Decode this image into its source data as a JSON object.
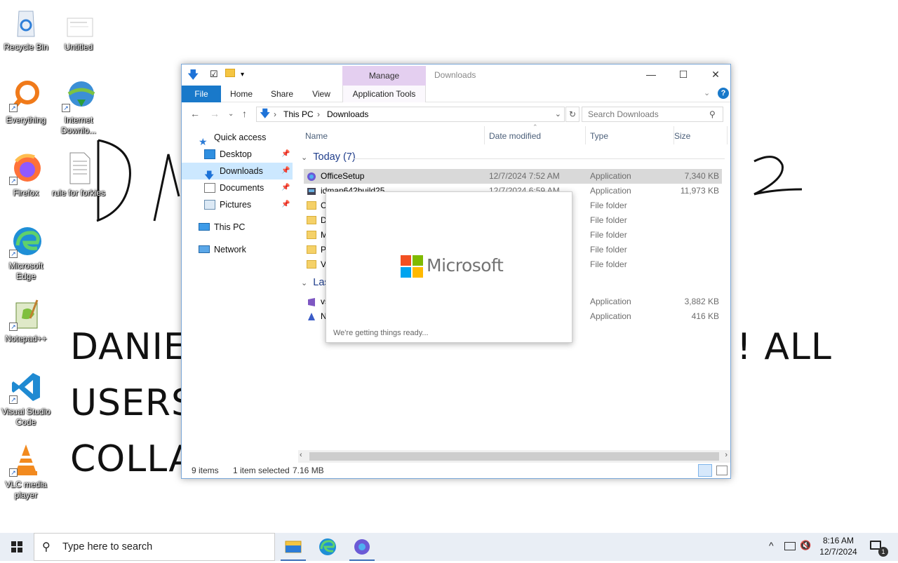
{
  "desktop": {
    "background_text": {
      "line1_left": "DANIE",
      "line1_right": "! ALL",
      "line2": "USERS",
      "line3": "COLLA",
      "scrawl_left": "DA",
      "scrawl_right": "2"
    },
    "icons": [
      {
        "label": "Recycle Bin",
        "icon": "recycle-bin-icon"
      },
      {
        "label": "Untitled",
        "icon": "document-icon"
      },
      {
        "label": "Everything",
        "icon": "everything-search-icon"
      },
      {
        "label": "Internet Downlo...",
        "icon": "internet-download-manager-icon"
      },
      {
        "label": "Firefox",
        "icon": "firefox-icon"
      },
      {
        "label": "rule for forkies",
        "icon": "text-file-icon"
      },
      {
        "label": "Microsoft Edge",
        "icon": "edge-icon"
      },
      {
        "label": "Notepad++",
        "icon": "notepad-plus-plus-icon"
      },
      {
        "label": "Visual Studio Code",
        "icon": "vscode-icon"
      },
      {
        "label": "VLC media player",
        "icon": "vlc-icon"
      }
    ]
  },
  "explorer": {
    "title": "Downloads",
    "manage_tab": "Manage",
    "ribbon_tabs": [
      "File",
      "Home",
      "Share",
      "View",
      "Application Tools"
    ],
    "address": {
      "root": "This PC",
      "folder": "Downloads"
    },
    "search_placeholder": "Search Downloads",
    "nav": {
      "quick_access": "Quick access",
      "desktop": "Desktop",
      "downloads": "Downloads",
      "documents": "Documents",
      "pictures": "Pictures",
      "this_pc": "This PC",
      "network": "Network"
    },
    "columns": {
      "name": "Name",
      "date": "Date modified",
      "type": "Type",
      "size": "Size"
    },
    "groups": {
      "today": "Today (7)",
      "last": "Last"
    },
    "rows": [
      {
        "name": "OfficeSetup",
        "date": "12/7/2024 7:52 AM",
        "type": "Application",
        "size": "7,340 KB"
      },
      {
        "name": "idman642build25",
        "date": "12/7/2024 6:59 AM",
        "type": "Application",
        "size": "11,973 KB"
      },
      {
        "name": "C",
        "date": "",
        "type": "File folder",
        "size": ""
      },
      {
        "name": "D",
        "date": "",
        "type": "File folder",
        "size": ""
      },
      {
        "name": "M",
        "date": "",
        "type": "File folder",
        "size": ""
      },
      {
        "name": "P",
        "date": "",
        "type": "File folder",
        "size": ""
      },
      {
        "name": "V",
        "date": "",
        "type": "File folder",
        "size": ""
      },
      {
        "name": "vs",
        "date": "",
        "type": "Application",
        "size": "3,882 KB"
      },
      {
        "name": "N",
        "date": "",
        "type": "Application",
        "size": "416 KB"
      }
    ],
    "status": {
      "count": "9 items",
      "selected": "1 item selected",
      "size": "7.16 MB"
    }
  },
  "splash": {
    "brand": "Microsoft",
    "message": "We're getting things ready..."
  },
  "taskbar": {
    "search_placeholder": "Type here to search",
    "time": "8:16 AM",
    "date": "12/7/2024",
    "notification_count": "1"
  }
}
